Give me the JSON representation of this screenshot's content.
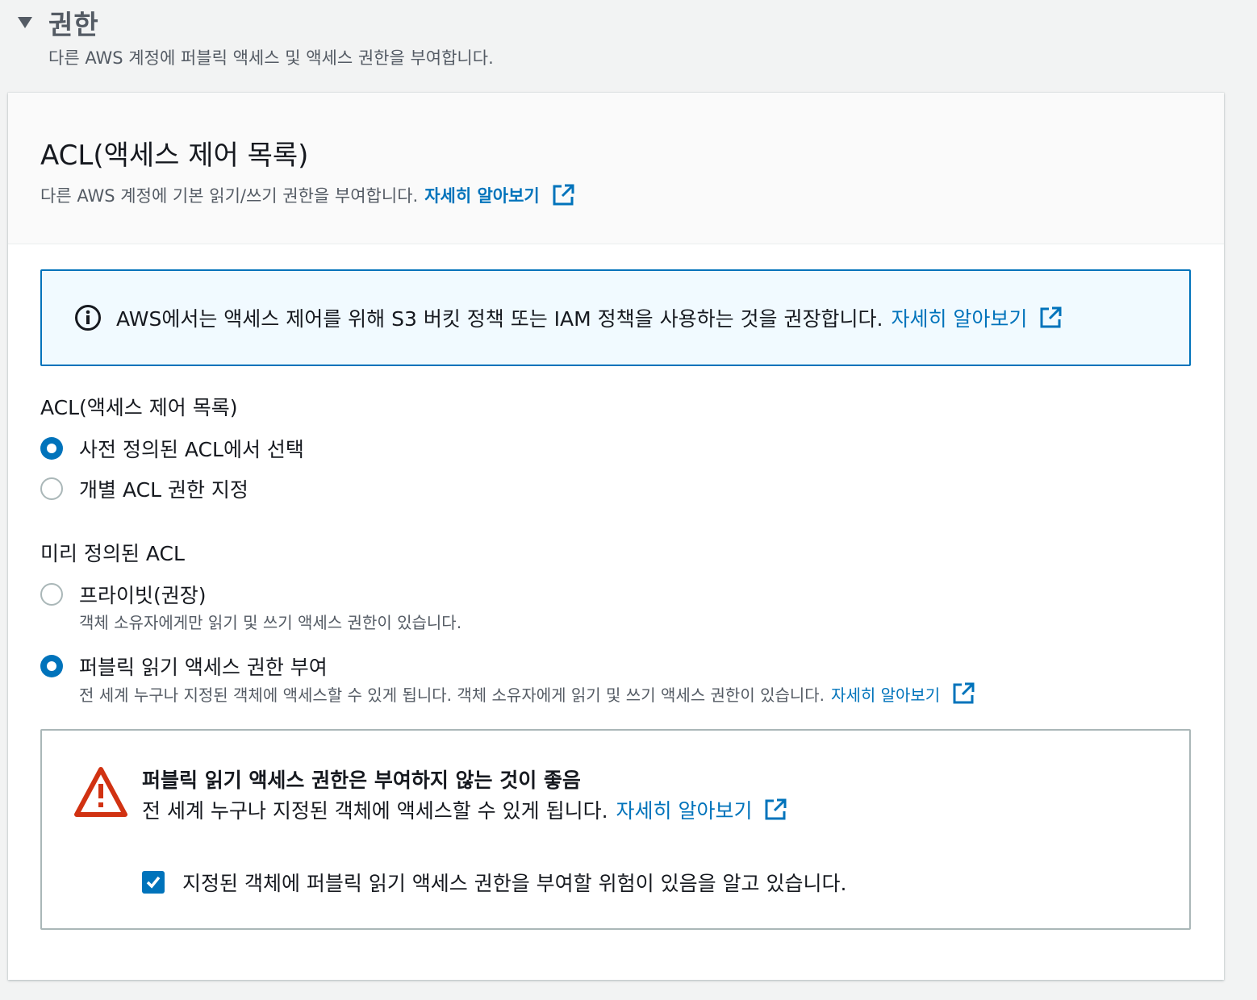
{
  "section": {
    "title": "권한",
    "description": "다른 AWS 계정에 퍼블릭 액세스 및 액세스 권한을 부여합니다."
  },
  "acl_panel": {
    "title": "ACL(액세스 제어 목록)",
    "description": "다른 AWS 계정에 기본 읽기/쓰기 권한을 부여합니다.",
    "learn_more": "자세히 알아보기"
  },
  "info_alert": {
    "text": "AWS에서는 액세스 제어를 위해 S3 버킷 정책 또는 IAM 정책을 사용하는 것을 권장합니다.",
    "learn_more": "자세히 알아보기"
  },
  "acl_mode": {
    "label": "ACL(액세스 제어 목록)",
    "options": [
      {
        "label": "사전 정의된 ACL에서 선택",
        "selected": true
      },
      {
        "label": "개별 ACL 권한 지정",
        "selected": false
      }
    ]
  },
  "predefined_acl": {
    "label": "미리 정의된 ACL",
    "options": [
      {
        "label": "프라이빗(권장)",
        "description": "객체 소유자에게만 읽기 및 쓰기 액세스 권한이 있습니다.",
        "selected": false
      },
      {
        "label": "퍼블릭 읽기 액세스 권한 부여",
        "description": "전 세계 누구나 지정된 객체에 액세스할 수 있게 됩니다. 객체 소유자에게 읽기 및 쓰기 액세스 권한이 있습니다.",
        "learn_more": "자세히 알아보기",
        "selected": true
      }
    ]
  },
  "warning": {
    "title": "퍼블릭 읽기 액세스 권한은 부여하지 않는 것이 좋음",
    "text": "전 세계 누구나 지정된 객체에 액세스할 수 있게 됩니다.",
    "learn_more": "자세히 알아보기",
    "acknowledge_label": "지정된 객체에 퍼블릭 읽기 액세스 권한을 부여할 위험이 있음을 알고 있습니다.",
    "acknowledged": true
  },
  "colors": {
    "accent": "#0073bb",
    "warning": "#d13212",
    "text": "#16191f",
    "muted": "#545b64"
  }
}
